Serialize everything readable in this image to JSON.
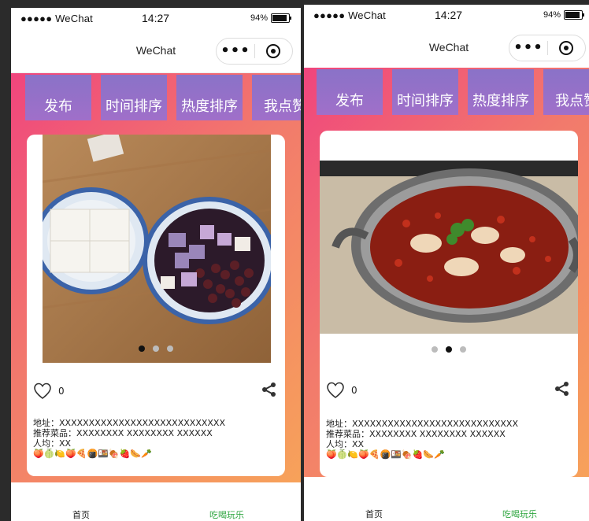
{
  "screens": [
    {
      "status": {
        "carrier": "●●●●● WeChat",
        "time": "14:27",
        "battery": "94%"
      },
      "nav_title": "WeChat",
      "tabs": [
        "发布",
        "时间排序",
        "热度排序",
        "我点赞"
      ],
      "post": {
        "likes": "0",
        "address": "地址：XXXXXXXXXXXXXXXXXXXXXXXXXXXX",
        "dishes": "推荐菜品：XXXXXXXX XXXXXXXX XXXXXX",
        "price": "人均：XX",
        "emoji": "🍑🍈🍋🍑🍕🍘🍱🍖🍓🌭🥕",
        "carousel_index": 0,
        "carousel_count": 3
      },
      "bottom_tabs": {
        "home": "首页",
        "fun": "吃喝玩乐"
      }
    },
    {
      "status": {
        "carrier": "●●●●● WeChat",
        "time": "14:27",
        "battery": "94%"
      },
      "nav_title": "WeChat",
      "tabs": [
        "发布",
        "时间排序",
        "热度排序",
        "我点赞"
      ],
      "post": {
        "likes": "0",
        "address": "地址：XXXXXXXXXXXXXXXXXXXXXXXXXXXX",
        "dishes": "推荐菜品：XXXXXXXX XXXXXXXX XXXXXX",
        "price": "人均：XX",
        "emoji": "🍑🍈🍋🍑🍕🍘🍱🍖🍓🌭🥕",
        "carousel_index": 1,
        "carousel_count": 3
      },
      "bottom_tabs": {
        "home": "首页",
        "fun": "吃喝玩乐"
      }
    }
  ],
  "colors": {
    "gradient_start": "#f0457d",
    "gradient_end": "#f7a25a",
    "tab_bg": "#8a72c8",
    "active_tab_text": "#2fa640"
  }
}
